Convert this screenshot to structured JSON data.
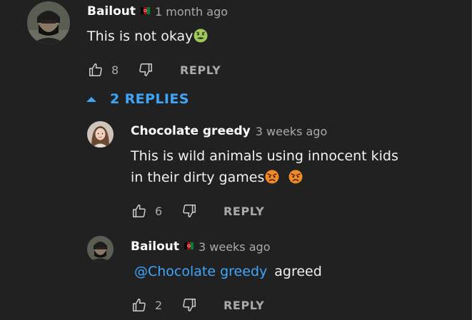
{
  "comments": [
    {
      "author": "Bailout",
      "flag": "afghanistan-flag",
      "time": "1 month ago",
      "text": "This is not okay",
      "emoji": "nauseated-face",
      "likes": "8",
      "reply_label": "REPLY"
    }
  ],
  "replies_toggle": {
    "label": "2 REPLIES",
    "icon": "caret-up-icon"
  },
  "replies": [
    {
      "author": "Chocolate greedy",
      "time": "3 weeks ago",
      "text_line1": "This is wild animals using innocent kids",
      "text_line2": "in their dirty games",
      "emojis": [
        "angry-face",
        "angry-face"
      ],
      "likes": "6",
      "reply_label": "REPLY"
    },
    {
      "author": "Bailout",
      "flag": "afghanistan-flag",
      "time": "3 weeks ago",
      "mention": "@Chocolate greedy",
      "text": "agreed",
      "likes": "2",
      "reply_label": "REPLY"
    }
  ],
  "colors": {
    "background": "#212121",
    "text": "#f1f1f1",
    "secondary": "#aaaaaa",
    "link": "#3ea6ff"
  }
}
